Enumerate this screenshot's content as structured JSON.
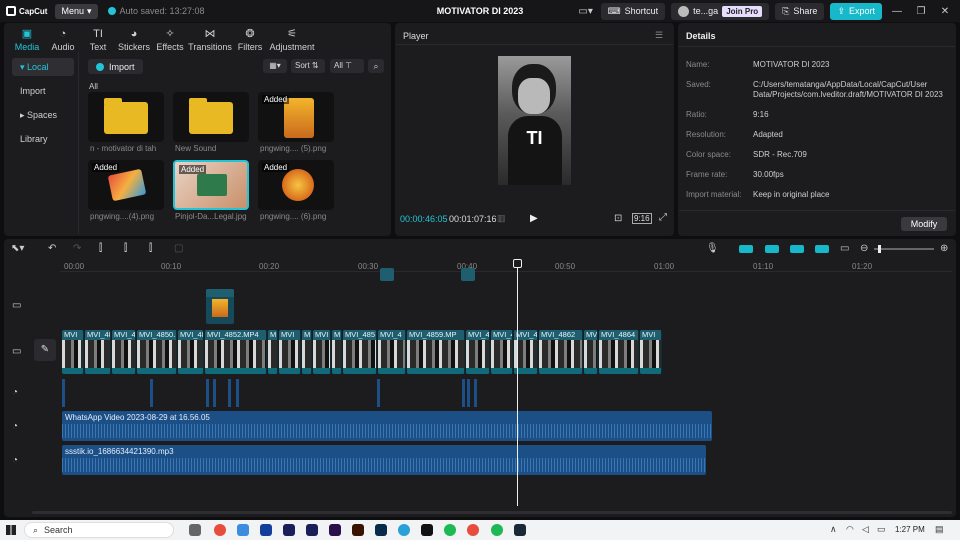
{
  "titlebar": {
    "logo": "CapCut",
    "menu": "Menu",
    "autosave": "Auto saved: 13:27:08",
    "project_title": "MOTIVATOR DI 2023",
    "shortcut": "Shortcut",
    "user": "te...ga",
    "join_pro": "Join Pro",
    "share": "Share",
    "export": "Export"
  },
  "media": {
    "tabs": [
      {
        "label": "Media",
        "icon": "media-icon"
      },
      {
        "label": "Audio",
        "icon": "audio-icon"
      },
      {
        "label": "Text",
        "icon": "text-icon"
      },
      {
        "label": "Stickers",
        "icon": "stickers-icon"
      },
      {
        "label": "Effects",
        "icon": "effects-icon"
      },
      {
        "label": "Transitions",
        "icon": "transitions-icon"
      },
      {
        "label": "Filters",
        "icon": "filters-icon"
      },
      {
        "label": "Adjustment",
        "icon": "adjustment-icon"
      }
    ],
    "side": [
      "Local",
      "Import",
      "Spaces",
      "Library"
    ],
    "import_label": "Import",
    "sort_label": "Sort",
    "all_label": "All",
    "all_heading": "All",
    "items": [
      {
        "caption": "n - motivator di tah",
        "added": ""
      },
      {
        "caption": "New Sound",
        "added": ""
      },
      {
        "caption": "pngwing.... (5).png",
        "added": "Added"
      },
      {
        "caption": "pngwing....(4).png",
        "added": "Added"
      },
      {
        "caption": "Pinjol-Da...Legal.jpg",
        "added": "Added"
      },
      {
        "caption": "pngwing.... (6).png",
        "added": "Added"
      }
    ]
  },
  "player": {
    "title": "Player",
    "overlay_text": "TI",
    "current_time": "00:00:46:05",
    "total_time": "00:01:07:16",
    "ratio_label": "9:16"
  },
  "details": {
    "title": "Details",
    "rows": [
      {
        "label": "Name:",
        "value": "MOTIVATOR DI 2023"
      },
      {
        "label": "Saved:",
        "value": "C:/Users/tematanga/AppData/Local/CapCut/User Data/Projects/com.lveditor.draft/MOTIVATOR DI 2023"
      },
      {
        "label": "Ratio:",
        "value": "9:16"
      },
      {
        "label": "Resolution:",
        "value": "Adapted"
      },
      {
        "label": "Color space:",
        "value": "SDR - Rec.709"
      },
      {
        "label": "Frame rate:",
        "value": "30.00fps"
      },
      {
        "label": "Import material:",
        "value": "Keep in original place"
      }
    ],
    "modify": "Modify"
  },
  "timeline": {
    "ruler": [
      "00:00",
      "00:10",
      "00:20",
      "00:30",
      "00:40",
      "00:50",
      "01:00",
      "01:10",
      "01:20"
    ],
    "clip_labels": [
      "MVI",
      "MVI_48",
      "MVI_4",
      "MVI_4850.",
      "MVI_4851",
      "MVI_4852.MP4",
      "M",
      "MVI",
      "M",
      "MVI",
      "M",
      "MVI_485",
      "MVI_4",
      "MVI_4859.MP",
      "MVI_4",
      "MVI_4",
      "MVI_4",
      "MVI_4862",
      "MVI",
      "MVI_4864",
      "MVI"
    ],
    "audio1": "WhatsApp Video 2023-08-29 at 16.56.05",
    "audio2": "ssstik.io_1686634421390.mp3"
  },
  "taskbar": {
    "search": "Search",
    "time": "1:27 PM"
  }
}
